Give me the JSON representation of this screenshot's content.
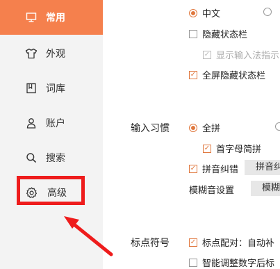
{
  "sidebar": {
    "items": [
      {
        "label": "常用",
        "icon": "monitor-icon"
      },
      {
        "label": "外观",
        "icon": "shirt-icon"
      },
      {
        "label": "词库",
        "icon": "book-icon"
      },
      {
        "label": "账户",
        "icon": "user-icon"
      },
      {
        "label": "搜索",
        "icon": "search-icon"
      },
      {
        "label": "高级",
        "icon": "gear-icon"
      }
    ],
    "active_item": "常用",
    "accent": "#f5804d"
  },
  "settings": {
    "lang_chinese": "中文",
    "hide_statusbar": "隐藏状态栏",
    "show_ime_hint": "显示输入法指示",
    "fullscreen_hide_statusbar": "全屏隐藏状态栏",
    "input_habit_label": "输入习惯",
    "full_pinyin": "全拼",
    "initial_jianpin": "首字母简拼",
    "pinyin_correction": "拼音纠错",
    "pinyin_correction_btn": "拼音纠",
    "fuzzy_sound_label": "模糊音设置",
    "fuzzy_sound_btn": "模糊",
    "punctuation_label": "标点符号",
    "punct_pairing": "标点配对：自动补",
    "smart_adjust_digits": "智能调整数字后标"
  },
  "annotation": {
    "color": "#ee1c1c",
    "highlight_target": "高级"
  }
}
